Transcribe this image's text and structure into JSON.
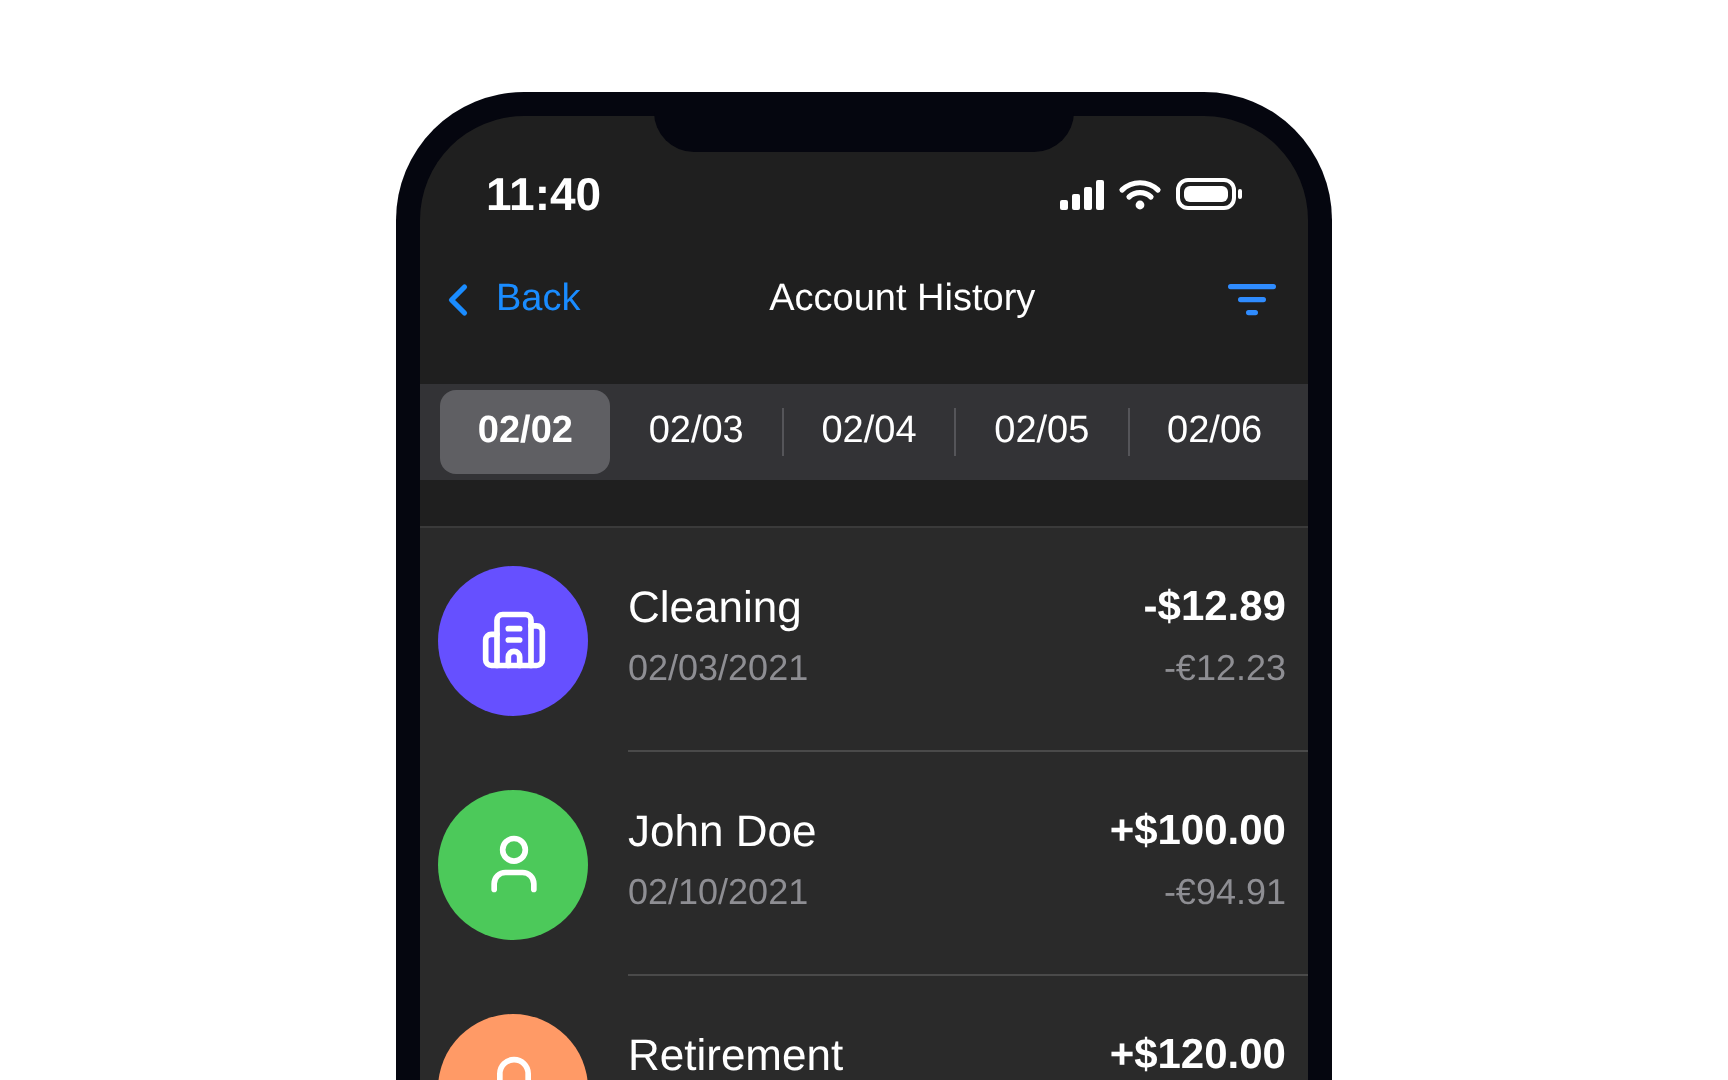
{
  "status_bar": {
    "time": "11:40"
  },
  "nav": {
    "back": "Back",
    "title": "Account History"
  },
  "date_tabs": [
    {
      "label": "02/02",
      "selected": true
    },
    {
      "label": "02/03",
      "selected": false
    },
    {
      "label": "02/04",
      "selected": false
    },
    {
      "label": "02/05",
      "selected": false
    },
    {
      "label": "02/06",
      "selected": false
    }
  ],
  "transactions": [
    {
      "kind": "building",
      "color": "#6650ff",
      "name": "Cleaning",
      "date": "02/03/2021",
      "amount": "-$12.89",
      "converted": "-€12.23"
    },
    {
      "kind": "person",
      "color": "#4cc95a",
      "name": "John Doe",
      "date": "02/10/2021",
      "amount": "+$100.00",
      "converted": "-€94.91"
    },
    {
      "kind": "lock",
      "color": "#ff9a66",
      "name": "Retirement",
      "amount": "+$120.00"
    }
  ]
}
